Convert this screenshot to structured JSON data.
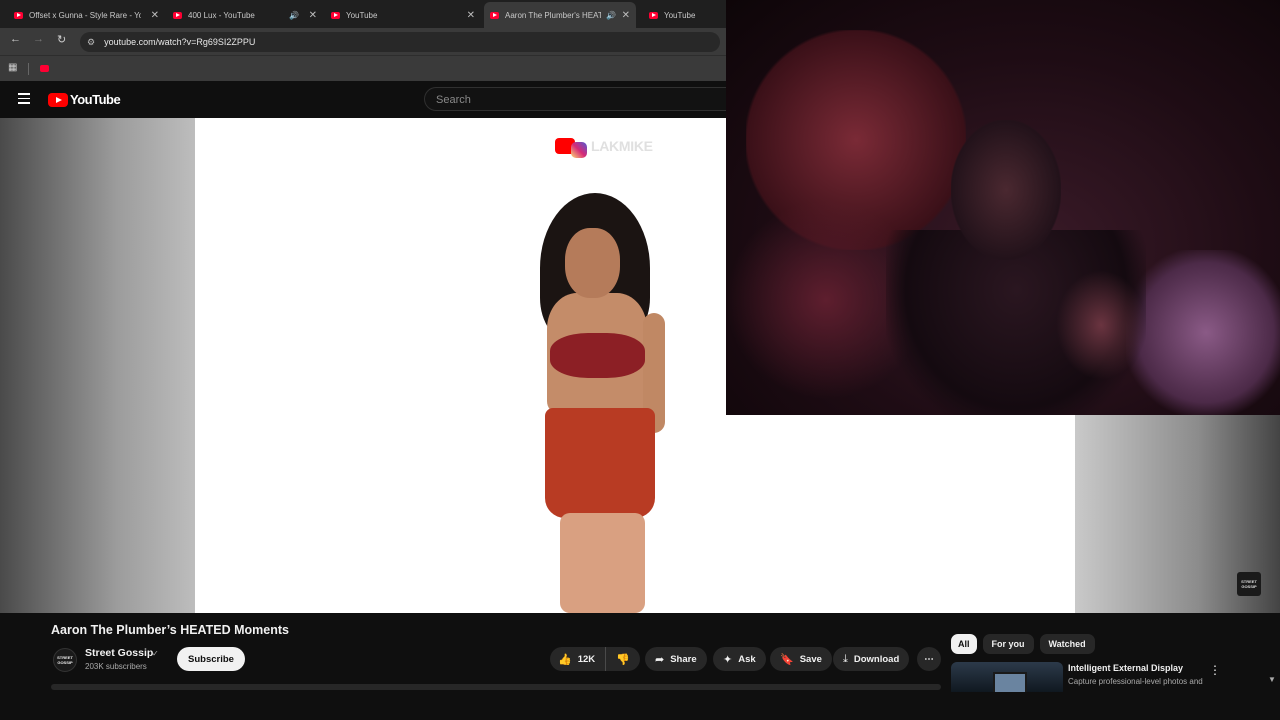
{
  "browser": {
    "tabs": [
      {
        "label": "Offset x Gunna - Style Rare - Yo",
        "active": false,
        "audio": false
      },
      {
        "label": "400 Lux - YouTube",
        "active": false,
        "audio": true
      },
      {
        "label": "YouTube",
        "active": false,
        "audio": false
      },
      {
        "label": "Aaron The Plumber's HEAT",
        "active": true,
        "audio": true
      },
      {
        "label": "YouTube",
        "active": false,
        "audio": false
      }
    ],
    "url": "youtube.com/watch?v=Rg69SI2ZPPU",
    "close_glyph": "✕",
    "audio_glyph": "🔊"
  },
  "youtube": {
    "logo_text": "YouTube",
    "search_placeholder": "Search"
  },
  "video": {
    "watermark": "LAKMIKE",
    "corner_logo": "STREET GOSSIP"
  },
  "details": {
    "title": "Aaron The Plumber’s HEATED Moments",
    "channel_name": "Street Gossip",
    "channel_avatar": "STREET GOSSIP",
    "verified_glyph": "✓",
    "subscribers": "203K subscribers",
    "subscribe_label": "Subscribe",
    "likes": "12K",
    "share_label": "Share",
    "ask_label": "Ask",
    "save_label": "Save",
    "download_label": "Download",
    "more_glyph": "⋯"
  },
  "sidebar": {
    "chips": [
      "All",
      "For you",
      "Watched"
    ],
    "selected_chip": "All",
    "recommendation": {
      "title": "Intelligent External Display",
      "description": "Capture professional-level photos and"
    }
  },
  "colors": {
    "youtube_red": "#ff0000",
    "page_bg": "#0f0f0f",
    "button_bg": "#272727"
  }
}
